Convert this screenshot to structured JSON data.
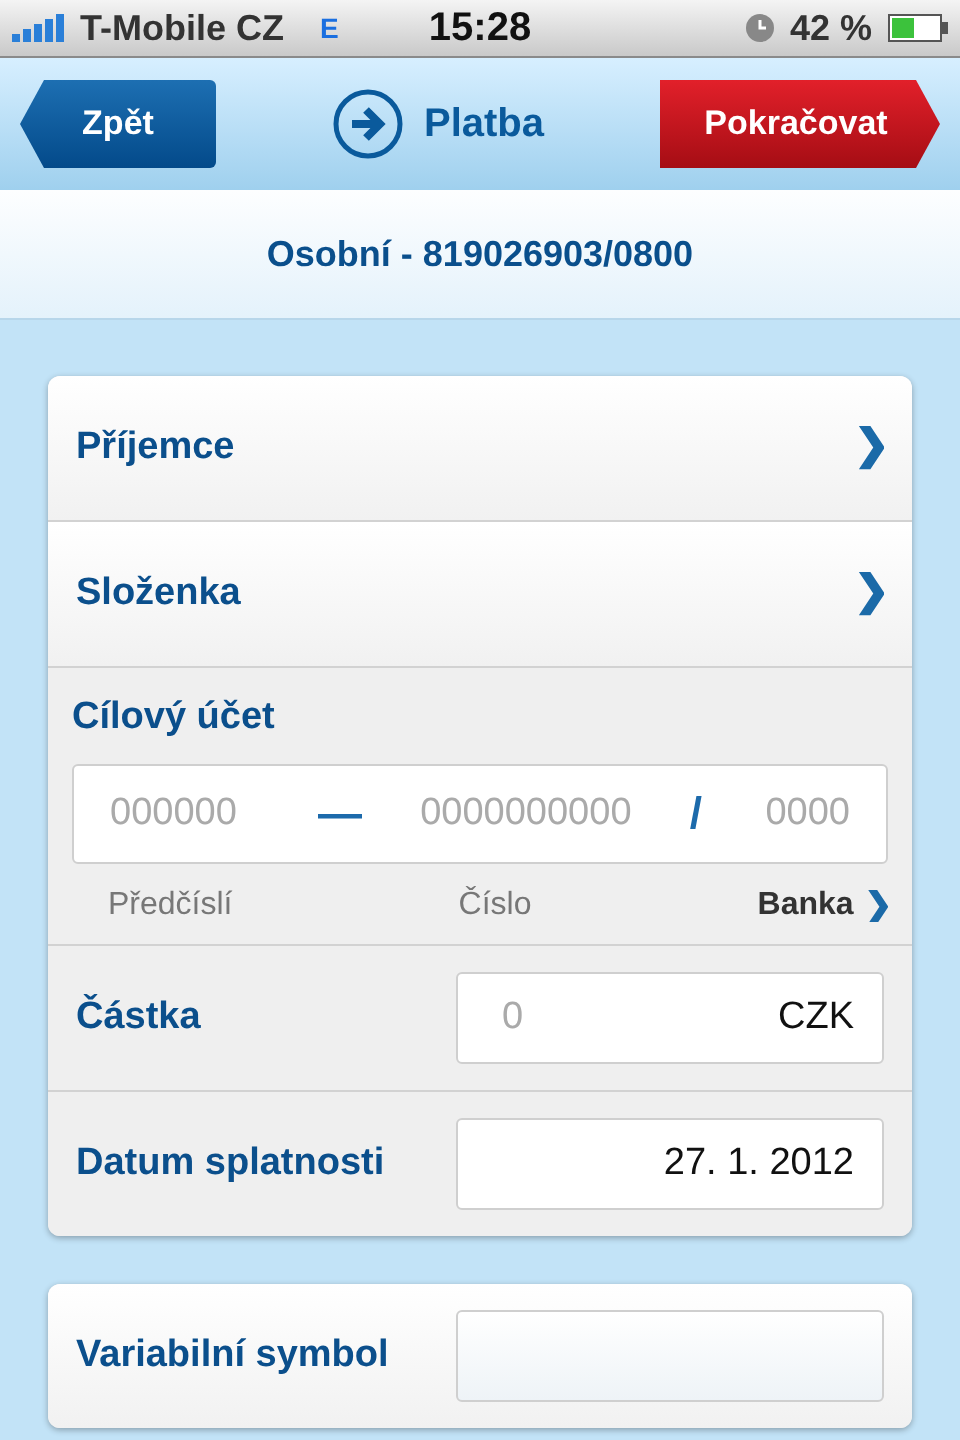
{
  "status_bar": {
    "carrier": "T-Mobile CZ",
    "network": "E",
    "time": "15:28",
    "battery": "42 %"
  },
  "nav": {
    "back": "Zpět",
    "title": "Platba",
    "next": "Pokračovat"
  },
  "account": "Osobní - 819026903/0800",
  "form": [
    {
      "kind": "link",
      "label": "Příjemce"
    },
    {
      "kind": "link",
      "label": "Složenka"
    },
    {
      "kind": "account",
      "label": "Cílový účet",
      "prefix_placeholder": "000000",
      "dash": "—",
      "number_placeholder": "0000000000",
      "slash": "/",
      "bank_placeholder": "0000",
      "prefix_label": "Předčíslí",
      "number_label": "Číslo",
      "bank_label": "Banka"
    },
    {
      "kind": "amount",
      "label": "Částka",
      "placeholder": "0",
      "currency": "CZK"
    },
    {
      "kind": "date",
      "label": "Datum splatnosti",
      "value": "27. 1. 2012"
    }
  ],
  "extra": [
    {
      "kind": "text",
      "label": "Variabilní symbol"
    }
  ]
}
